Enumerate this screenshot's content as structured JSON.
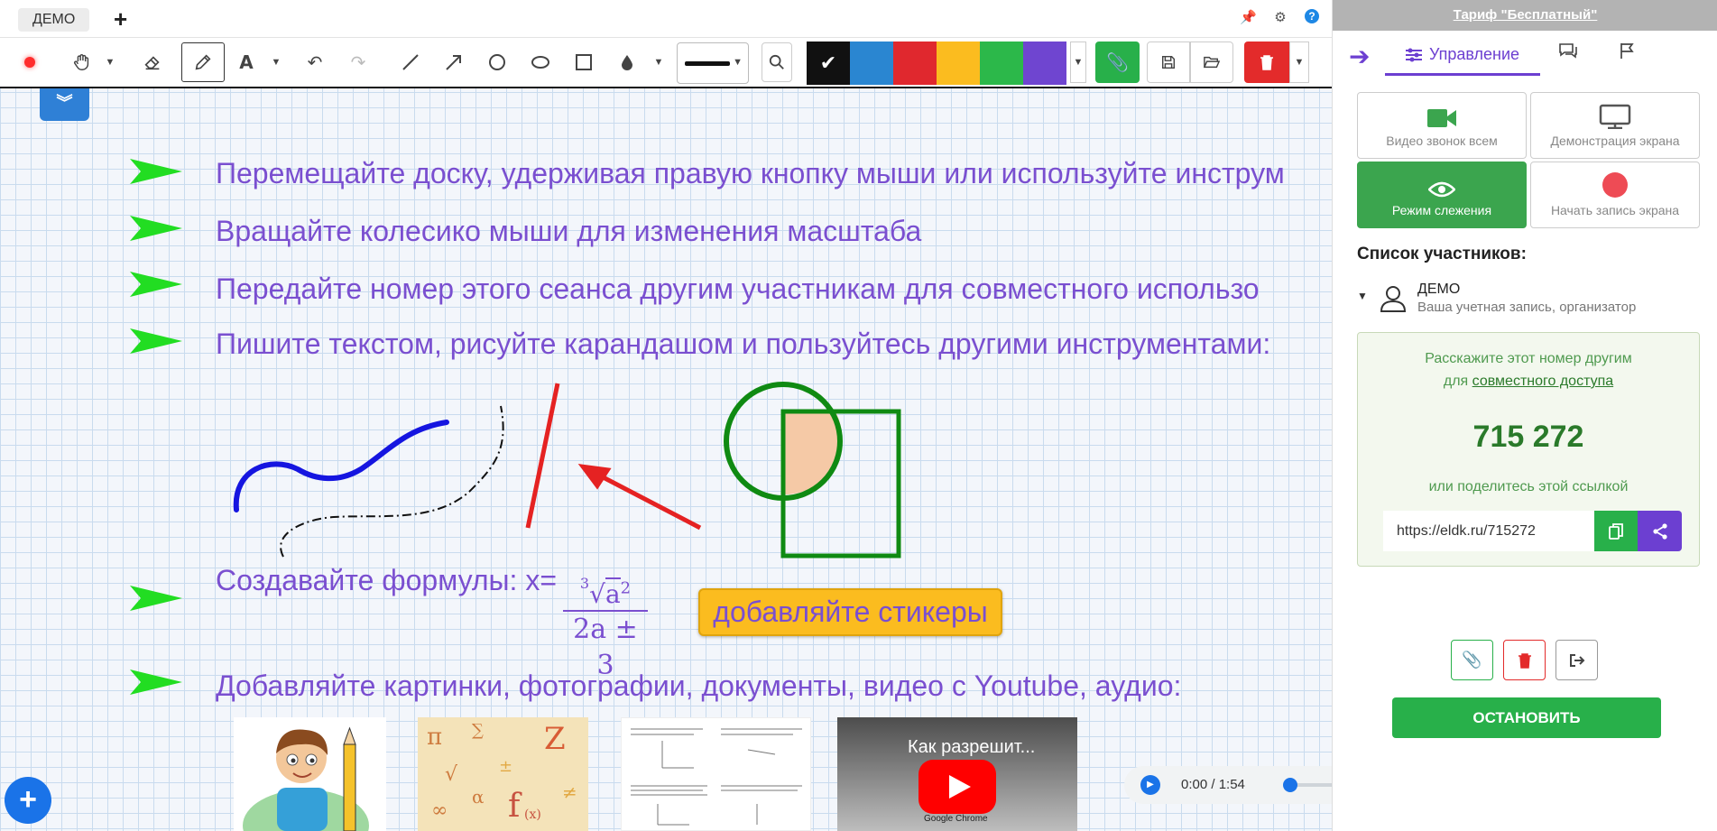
{
  "tabs": {
    "active": "ДЕМО",
    "add": "+"
  },
  "top_icons": [
    "pin-icon",
    "gear-icon",
    "help-icon"
  ],
  "top_icon_glyphs": {
    "pin": "📌",
    "gear": "⚙",
    "help": "?"
  },
  "toolbar": {
    "tools": [
      "record-icon",
      "hand-icon",
      "eraser-icon",
      "pencil-icon",
      "text-icon",
      "undo-icon",
      "redo-icon",
      "line-icon",
      "arrow-icon",
      "circle-icon",
      "ellipse-icon",
      "rectangle-icon",
      "fill-icon",
      "search-icon"
    ],
    "colors": [
      "#111111",
      "#2a86d1",
      "#e0282e",
      "#fbbc1f",
      "#2cb84a",
      "#6f45d0"
    ],
    "selected_color": "#111111"
  },
  "board": {
    "instructions": [
      "Перемещайте доску, удерживая правую кнопку мыши или используйте инструм",
      "Вращайте колесико мыши для изменения масштаба",
      "Передайте номер этого сеанса другим участникам для совместного использо",
      "Пишите текстом, рисуйте карандашом и пользуйтесь другими инструментами:"
    ],
    "formula_label": "Создавайте формулы: x=",
    "formula": {
      "root_index": "3",
      "radicand": "a",
      "exponent": "2",
      "denominator": "2a ± 3"
    },
    "sticker": "добавляйте стикеры",
    "media_label": "Добавляйте картинки, фотографии, документы, видео с Youtube, аудио:",
    "video_title": "Как разрешит...",
    "video_caption": "Google Chrome",
    "audio_time": "0:00 / 1:54",
    "accent_color": "#7a4fd0"
  },
  "panel": {
    "tariff": "Тариф \"Бесплатный\"",
    "tabs": {
      "control": "Управление"
    },
    "tiles": {
      "video_call": "Видео звонок всем",
      "screen_share": "Демонстрация экрана",
      "follow_mode": "Режим слежения",
      "record_screen": "Начать запись экрана"
    },
    "participants_title": "Список участников:",
    "participant": {
      "name": "ДЕМО",
      "role": "Ваша учетная запись, организатор"
    },
    "share": {
      "line1": "Расскажите этот номер другим",
      "line2_prefix": "для ",
      "line2_link": "совместного доступа",
      "code": "715 272",
      "line3": "или поделитесь этой ссылкой",
      "url": "https://eldk.ru/715272"
    },
    "stop_button": "ОСТАНОВИТЬ"
  }
}
